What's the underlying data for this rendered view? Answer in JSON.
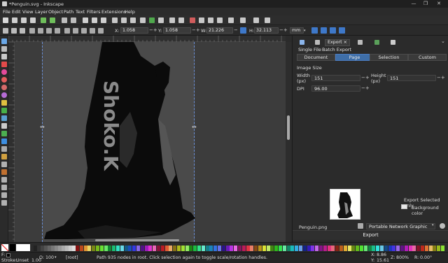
{
  "window": {
    "title": "*Penguin.svg - Inkscape",
    "controls": [
      "—",
      "❐",
      "✕"
    ]
  },
  "menu": [
    "File",
    "Edit",
    "View",
    "Layer",
    "Object",
    "Path",
    "Text",
    "Filters",
    "Extensions",
    "Help"
  ],
  "tool_controls": {
    "x_label": "X:",
    "x_value": "1.058",
    "y_label": "Y:",
    "y_value": "1.058",
    "w_label": "W:",
    "w_value": "21.226",
    "h_label": "H:",
    "h_value": "32.113",
    "unit": "mm"
  },
  "canvas": {
    "watermark_text": "Shoko.K"
  },
  "dock": {
    "active_tab": "Export",
    "subtabs": [
      "Single File",
      "Batch Export"
    ],
    "area_buttons": [
      "Document",
      "Page",
      "Selection",
      "Custom"
    ],
    "active_area": "Page",
    "image_size_heading": "Image Size",
    "width_label": "Width (px)",
    "width_value": "151",
    "height_label": "Height (px)",
    "height_value": "151",
    "dpi_label": "DPI",
    "dpi_value": "96.00",
    "export_selected_only": "Export Selected only",
    "background_color": "Background color",
    "filename": "Penguin.png",
    "format": "Portable Network Graphic (*.png)",
    "export_button": "Export"
  },
  "status": {
    "fill_label": "F:",
    "stroke_label": "Stroke:",
    "stroke_value": "Unset",
    "stroke_width": "1.00",
    "opacity_label": "O:",
    "opacity_value": "100",
    "layer_value": "[root]",
    "message": "Path 935 nodes in root. Click selection again to toggle scale/rotation handles.",
    "cursor_x_label": "X:",
    "cursor_x": "8.86",
    "cursor_y_label": "Y:",
    "cursor_y": "15.61",
    "zoom_label": "Z:",
    "zoom": "800%",
    "rotation_label": "R:",
    "rotation": "0.00°"
  },
  "colors": {
    "accent": "#3e6ea8",
    "background": "#2b2b2b",
    "canvas": "#3c3c3c"
  }
}
